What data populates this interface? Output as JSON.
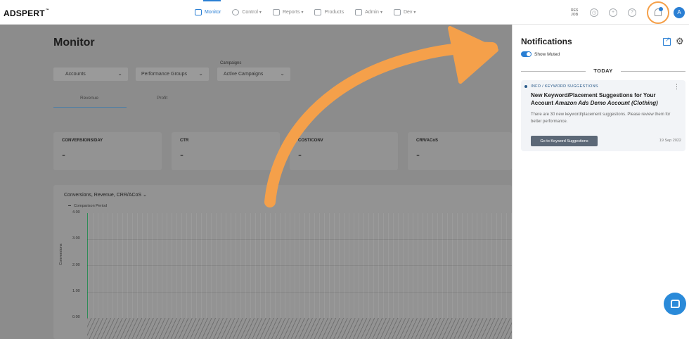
{
  "app": {
    "logo": "ADSPERT",
    "logo_tm": "™"
  },
  "nav": [
    {
      "label": "Monitor",
      "active": true
    },
    {
      "label": "Control",
      "caret": "▾"
    },
    {
      "label": "Reports",
      "caret": "▾"
    },
    {
      "label": "Products"
    },
    {
      "label": "Admin",
      "caret": "▾"
    },
    {
      "label": "Dev",
      "caret": "▾"
    }
  ],
  "header_icons": {
    "doc_icon_text": "RES JOB",
    "help": "?",
    "avatar": "A"
  },
  "main": {
    "title": "Monitor",
    "filters": {
      "accounts": "Accounts",
      "groups": "Performance Groups",
      "campaigns_label": "Campaigns",
      "campaigns": "Active Campaigns",
      "dd": "⌄"
    },
    "tabs": {
      "revenue": "Revenue",
      "profit": "Profit"
    },
    "metrics": [
      {
        "label": "CONVERSIONS/DAY",
        "value": "-"
      },
      {
        "label": "CTR",
        "value": "-"
      },
      {
        "label": "COST/CONV",
        "value": "-"
      },
      {
        "label": "CRR/ACoS",
        "value": "-"
      }
    ],
    "chart": {
      "selector": "Conversions, Revenue, CRR/ACoS ⌄",
      "legend": "Comparison Period",
      "ylabel": "Conversions",
      "yticks": [
        "4.00",
        "3.00",
        "2.00",
        "1.00",
        "0.00"
      ]
    }
  },
  "notifications": {
    "title": "Notifications",
    "show_muted": "Show Muted",
    "today": "TODAY",
    "card": {
      "category": "INFO / KEYWORD SUGGESTIONS",
      "more": "⋮",
      "heading_pre": "New Keyword/Placement Suggestions for Your Account ",
      "heading_account": "Amazon Ads Demo Account (Clothing)",
      "body": "There are 30 new keyword/placement suggestions. Please review them for better performance.",
      "button": "Go to Keyword Suggestions",
      "date": "19 Sep 2022"
    },
    "gear": "⚙"
  },
  "colors": {
    "accent": "#2a7fd4",
    "highlight": "#f5a04a",
    "overlay": "#8c8c8c"
  }
}
